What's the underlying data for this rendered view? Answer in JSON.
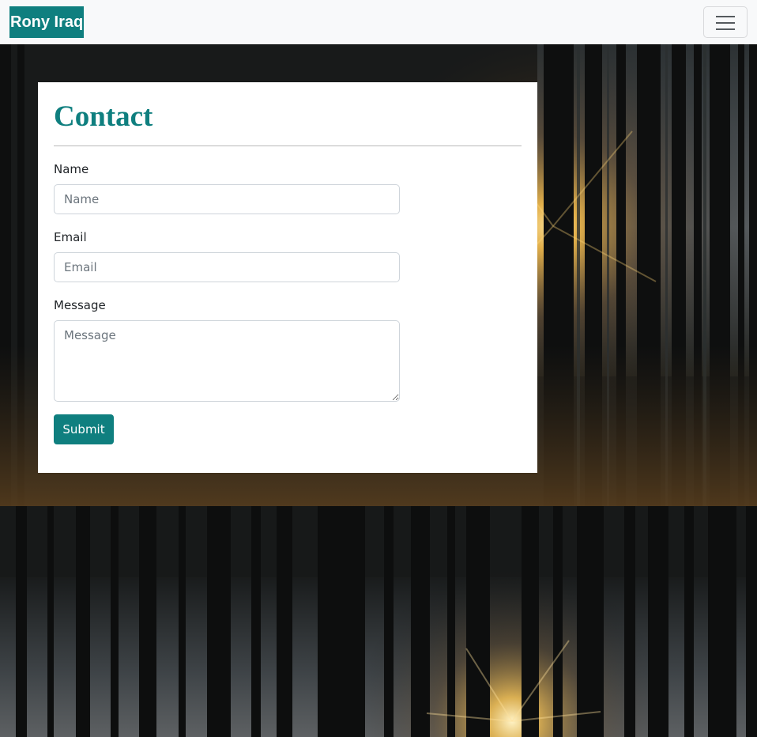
{
  "navbar": {
    "brand": "Rony Iraq",
    "toggler_icon": "hamburger-menu-icon",
    "brand_color": "#0f7f7f",
    "background_color": "#f8f9fa"
  },
  "contact": {
    "title": "Contact",
    "title_color": "#0f7f7f",
    "fields": {
      "name": {
        "label": "Name",
        "placeholder": "Name",
        "value": ""
      },
      "email": {
        "label": "Email",
        "placeholder": "Email",
        "value": ""
      },
      "message": {
        "label": "Message",
        "placeholder": "Message",
        "value": ""
      }
    },
    "submit_label": "Submit",
    "submit_color": "#0f7f7f"
  },
  "background": {
    "description_icon": "forest-sunset-photo"
  }
}
